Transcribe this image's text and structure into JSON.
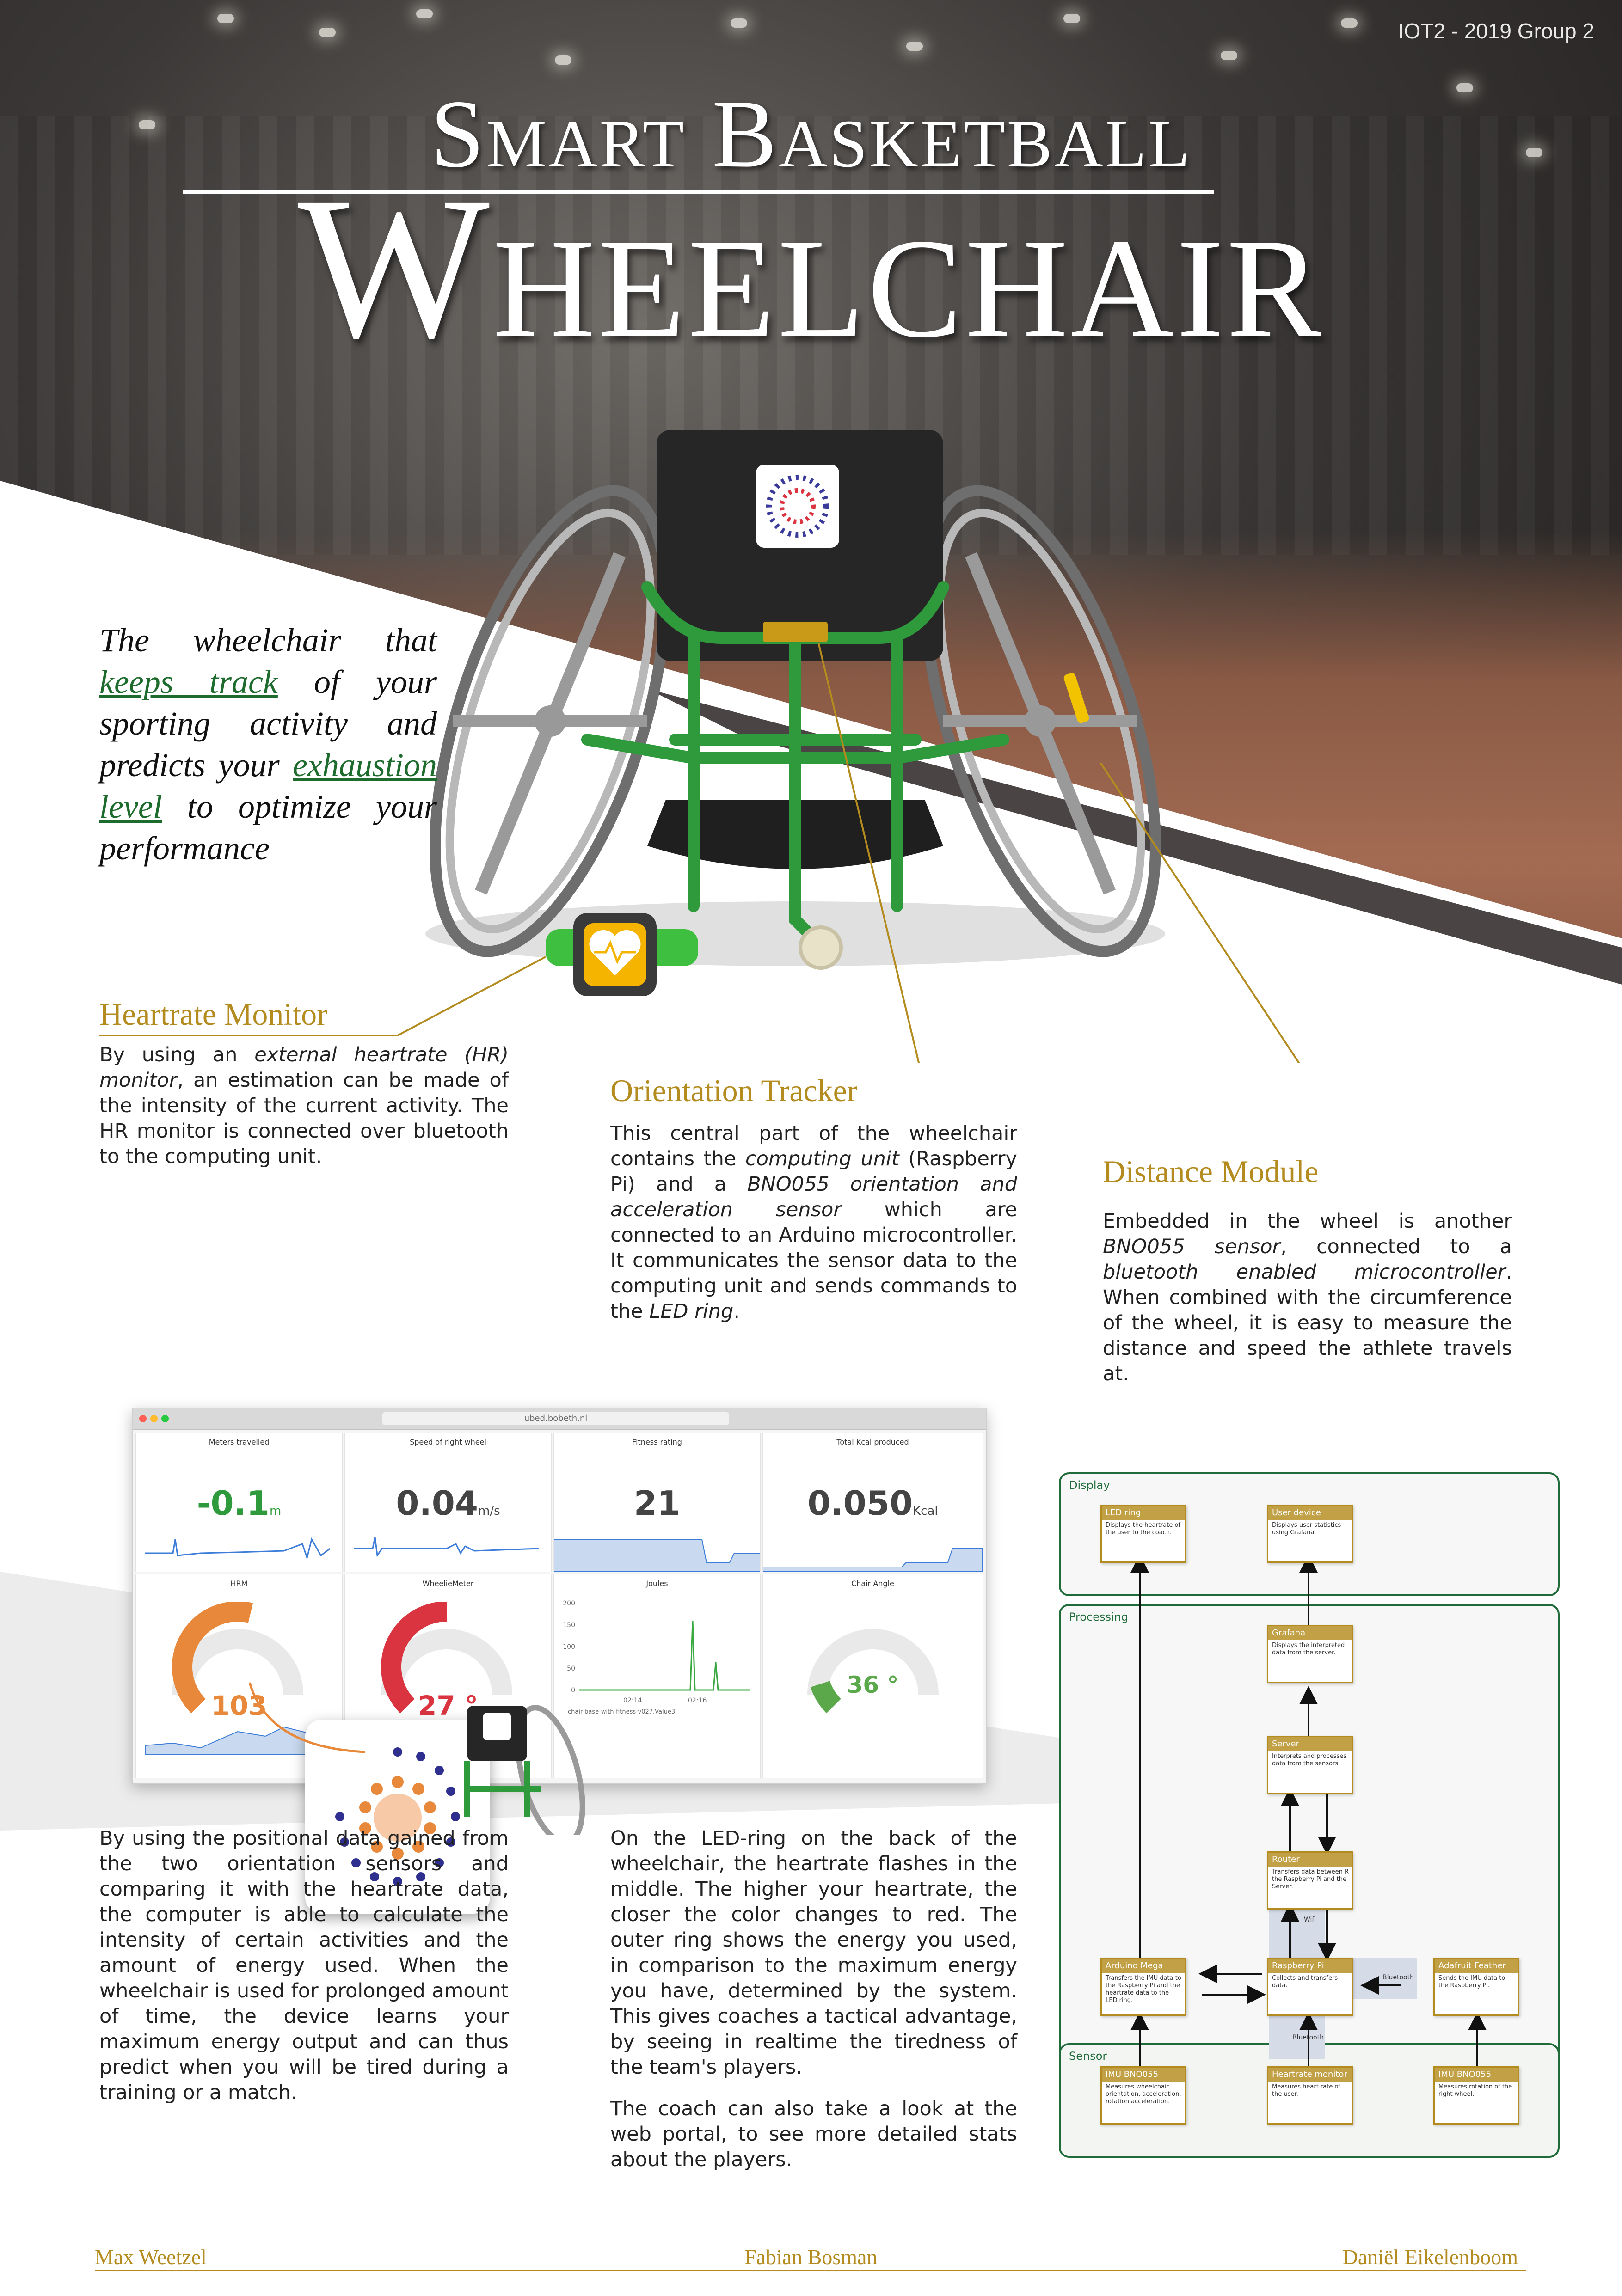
{
  "group_tag": "IOT2 - 2019 Group 2",
  "title": {
    "small": "Smart Basketball",
    "big": "Wheelchair"
  },
  "tagline": {
    "p1": "The wheelchair that ",
    "h1": "keeps track",
    "p2": " of your sporting activity and predicts your ",
    "h2": "exhaustion level",
    "p3": " to optimize your performance"
  },
  "sections": {
    "heartrate": {
      "title": "Heartrate Monitor",
      "t1": "By using an ",
      "i1": "external heartrate (HR) monitor",
      "t2": ", an estimation can be made of the intensity of the current activity. The HR monitor is connected over bluetooth to the computing unit."
    },
    "orientation": {
      "title": "Orientation Tracker",
      "t1": "This central part of the wheelchair contains the ",
      "i1": "computing unit",
      "t2": " (Raspberry Pi) and a ",
      "i2": "BNO055 orientation and acceleration sensor",
      "t3": " which are connected to an Arduino microcontroller. It communicates the sensor data to the computing unit and sends commands to the ",
      "i3": "LED ring",
      "t4": "."
    },
    "distance": {
      "title": "Distance Module",
      "t1": "Embedded in the wheel is another ",
      "i1": "BNO055 sensor",
      "t2": ", connected to a ",
      "i2": "bluetooth enabled microcontroller",
      "t3": ". When combined with the circumference of the wheel, it is easy to measure the distance and speed the athlete travels at."
    }
  },
  "body_left": "By using the positional data gained from the two orientation sensors and comparing it with the heartrate data, the computer is able to calculate the intensity of certain activities and the amount of energy used. When the wheelchair is used for prolonged amount of time, the device learns your maximum energy output and can thus predict when you will be tired during a training or a match.",
  "body_middle_1": "On the LED-ring on the back of the wheelchair, the heartrate flashes in the middle. The higher your heartrate, the closer the color changes to red. The outer ring shows the energy you used, in comparison to the maximum energy you have, determined by the system. This gives coaches a tactical advantage, by seeing in realtime the tiredness of the team's players.",
  "body_middle_2": "The coach can also take a look at the web portal, to see more detailed stats about the players.",
  "dashboard": {
    "url": "ubed.bobeth.nl",
    "panels": [
      {
        "title": "Meters travelled",
        "value": "-0.1",
        "unit": "m",
        "color": "#2e9a3c"
      },
      {
        "title": "Speed of right wheel",
        "value": "0.04",
        "unit": "m/s",
        "color": "#444444"
      },
      {
        "title": "Fitness rating",
        "value": "21",
        "unit": "",
        "color": "#444444"
      },
      {
        "title": "Total Kcal produced",
        "value": "0.050",
        "unit": "Kcal",
        "color": "#444444"
      }
    ],
    "gauges": [
      {
        "title": "HRM",
        "value": "103",
        "fraction": 0.55,
        "color": "#e8883a"
      },
      {
        "title": "WheelieMeter",
        "value": "27 °",
        "fraction": 0.5,
        "color": "#d9343f"
      },
      {
        "title": "Chair Angle",
        "value": "36 °",
        "fraction": 0.1,
        "color": "#5aa84a"
      }
    ],
    "joules": {
      "title": "Joules",
      "yticks": [
        "200",
        "150",
        "100",
        "50",
        "0"
      ],
      "xticks": [
        "02:14",
        "02:16"
      ],
      "legend": "chair-base-with-fitness-v027.Value3"
    }
  },
  "architecture": {
    "zones": {
      "display": "Display",
      "processing": "Processing",
      "sensor": "Sensor"
    },
    "boxes": {
      "led": {
        "title": "LED ring",
        "desc": "Displays the heartrate of the user to the coach."
      },
      "user": {
        "title": "User device",
        "desc": "Displays user statistics using Grafana."
      },
      "grafana": {
        "title": "Grafana",
        "desc": "Displays the interpreted data from the server."
      },
      "server": {
        "title": "Server",
        "desc": "Interprets and processes data from the sensors."
      },
      "router": {
        "title": "Router",
        "desc": "Transfers data between R the Raspberry Pi and the Server."
      },
      "arduino": {
        "title": "Arduino Mega",
        "desc": "Transfers the IMU data to the Raspberry Pi and the heartrate data to the LED ring."
      },
      "rpi": {
        "title": "Raspberry Pi",
        "desc": "Collects and transfers data."
      },
      "feather": {
        "title": "Adafruit Feather",
        "desc": "Sends the IMU data to the Raspberry Pi."
      },
      "imu1": {
        "title": "IMU BNO055",
        "desc": "Measures wheelchair orientation, acceleration, rotation acceleration."
      },
      "hrm": {
        "title": "Heartrate monitor",
        "desc": "Measures heart rate of the user."
      },
      "imu2": {
        "title": "IMU BNO055",
        "desc": "Measures rotation of the right wheel."
      }
    },
    "labels": {
      "wifi": "Wifi",
      "bt1": "Bluetooth",
      "bt2": "Bluetooth"
    }
  },
  "authors": [
    "Max Weetzel",
    "Fabian Bosman",
    "Daniël Eikelenboom"
  ],
  "colors": {
    "gold": "#b38b1f",
    "green": "#1e6b2e",
    "chair_green": "#2e9a3c"
  }
}
